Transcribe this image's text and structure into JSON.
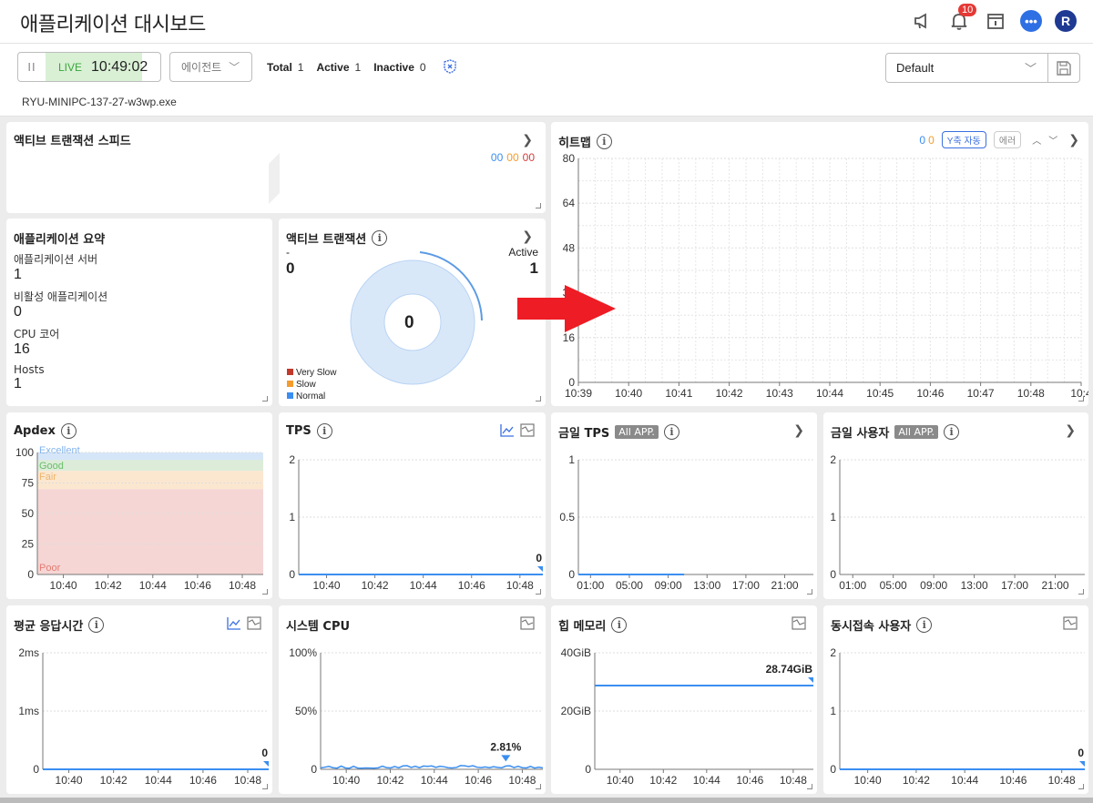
{
  "header": {
    "title": "애플리케이션 대시보드",
    "notification_count": "10",
    "avatar_initial": "R",
    "icons": [
      "megaphone-icon",
      "bell-icon",
      "calendar-info-icon",
      "chat-icon",
      "avatar"
    ]
  },
  "toolbar": {
    "pause_glyph": "II",
    "live_label": "LIVE",
    "live_time": "10:49:02",
    "agent_dropdown": "에이전트",
    "total_label": "Total",
    "total_value": "1",
    "active_label": "Active",
    "active_value": "1",
    "inactive_label": "Inactive",
    "inactive_value": "0",
    "process_name": "RYU-MINIPC-137-27-w3wp.exe",
    "preset": "Default"
  },
  "cards": {
    "speed": {
      "title": "액티브 트랜잭션 스피드",
      "v1": "00",
      "v2": "00",
      "v3": "00",
      "colors": [
        "#3b8ef0",
        "#f39c2c",
        "#d63b3b"
      ]
    },
    "heatmap": {
      "title": "히트맵",
      "count_blue": "0",
      "count_orange": "0",
      "yaxis_button": "Y축 자동",
      "error_button": "에러"
    },
    "summary": {
      "title": "애플리케이션 요약",
      "items": [
        {
          "label": "애플리케이션 서버",
          "value": "1"
        },
        {
          "label": "비활성 애플리케이션",
          "value": "0"
        },
        {
          "label": "CPU 코어",
          "value": "16"
        },
        {
          "label": "Hosts",
          "value": "1"
        }
      ]
    },
    "active_tx": {
      "title": "액티브 트랜잭션",
      "left_label": "-",
      "left_value": "0",
      "right_label": "Active",
      "right_value": "1",
      "center_value": "0",
      "legend": [
        {
          "label": "Very Slow",
          "color": "#c0392b"
        },
        {
          "label": "Slow",
          "color": "#f39c2c"
        },
        {
          "label": "Normal",
          "color": "#3b8ef0"
        }
      ]
    },
    "apdex": {
      "title": "Apdex"
    },
    "tps": {
      "title": "TPS"
    },
    "today_tps": {
      "title": "금일 TPS",
      "pill": "All APP."
    },
    "today_users": {
      "title": "금일 사용자",
      "pill": "All APP."
    },
    "avg_resp": {
      "title": "평균 응답시간"
    },
    "sys_cpu": {
      "title": "시스템 CPU"
    },
    "heap": {
      "title": "힙 메모리"
    },
    "concurrent": {
      "title": "동시접속 사용자"
    }
  },
  "chart_data": [
    {
      "id": "heatmap",
      "type": "heatmap",
      "title": "히트맵",
      "yticks": [
        "0",
        "16",
        "32",
        "48",
        "64",
        "80"
      ],
      "ylim": [
        0,
        80
      ],
      "xticks": [
        "10:39",
        "10:40",
        "10:41",
        "10:42",
        "10:43",
        "10:44",
        "10:45",
        "10:46",
        "10:47",
        "10:48",
        "10:4"
      ],
      "values": []
    },
    {
      "id": "apdex",
      "type": "area",
      "title": "Apdex",
      "yticks": [
        "0",
        "25",
        "50",
        "75",
        "100"
      ],
      "ylim": [
        0,
        100
      ],
      "xticks": [
        "10:40",
        "10:42",
        "10:44",
        "10:46",
        "10:48"
      ],
      "bands": [
        {
          "label": "Excellent",
          "from": 94,
          "to": 100,
          "color": "#d6e6f9",
          "text": "#7fb2ee"
        },
        {
          "label": "Good",
          "from": 85,
          "to": 94,
          "color": "#dcecd9",
          "text": "#6abf69"
        },
        {
          "label": "Fair",
          "from": 70,
          "to": 85,
          "color": "#fbe7d0",
          "text": "#f0b46a"
        },
        {
          "label": "Poor",
          "from": 0,
          "to": 70,
          "color": "#f5d6d4",
          "text": "#e57c74"
        }
      ]
    },
    {
      "id": "tps",
      "type": "line",
      "title": "TPS",
      "yticks": [
        "0",
        "1",
        "2"
      ],
      "ylim": [
        0,
        2
      ],
      "xticks": [
        "10:40",
        "10:42",
        "10:44",
        "10:46",
        "10:48"
      ],
      "values": [
        0,
        0,
        0,
        0,
        0,
        0,
        0,
        0,
        0,
        0
      ],
      "last_label": "0"
    },
    {
      "id": "today_tps",
      "type": "line",
      "title": "금일 TPS",
      "yticks": [
        "0",
        "0.5",
        "1"
      ],
      "ylim": [
        0,
        1
      ],
      "xticks": [
        "01:00",
        "05:00",
        "09:00",
        "13:00",
        "17:00",
        "21:00"
      ],
      "values": [
        0,
        0,
        0,
        0,
        0,
        0,
        0,
        0,
        0,
        0,
        0
      ],
      "value_end_fraction": 0.45
    },
    {
      "id": "today_users",
      "type": "line",
      "title": "금일 사용자",
      "yticks": [
        "0",
        "1",
        "2"
      ],
      "ylim": [
        0,
        2
      ],
      "xticks": [
        "01:00",
        "05:00",
        "09:00",
        "13:00",
        "17:00",
        "21:00"
      ],
      "values": []
    },
    {
      "id": "avg_resp",
      "type": "line",
      "title": "평균 응답시간",
      "yticks": [
        "0",
        "1ms",
        "2ms"
      ],
      "ylim": [
        0,
        2
      ],
      "xticks": [
        "10:40",
        "10:42",
        "10:44",
        "10:46",
        "10:48"
      ],
      "values": [
        0,
        0,
        0,
        0,
        0,
        0,
        0,
        0,
        0,
        0
      ],
      "last_label": "0"
    },
    {
      "id": "sys_cpu",
      "type": "line",
      "title": "시스템 CPU",
      "yticks": [
        "0",
        "50%",
        "100%"
      ],
      "ylim": [
        0,
        100
      ],
      "xticks": [
        "10:40",
        "10:42",
        "10:44",
        "10:46",
        "10:48"
      ],
      "values": [
        1.2,
        1.8,
        2.5,
        1.4,
        1.0,
        2.8,
        1.2,
        0.9,
        2.6,
        1.1,
        1.0,
        1.2,
        1.1,
        1.0,
        1.3,
        2.7,
        1.5,
        1.2,
        2.4,
        1.3,
        2.9,
        3.1,
        1.6,
        2.6,
        1.4,
        2.8,
        2.5,
        2.9,
        1.7,
        2.6,
        2.2,
        1.4,
        1.2,
        1.6,
        3.2,
        3.0,
        2.4,
        3.1,
        1.8,
        1.5,
        2.0,
        1.4,
        2.2,
        1.7,
        1.3,
        2.81,
        3.0,
        1.5,
        2.6,
        1.4,
        1.2,
        2.5,
        1.1,
        1.8,
        1.2
      ],
      "marker_label": "2.81%",
      "marker_index": 45
    },
    {
      "id": "heap",
      "type": "line",
      "title": "힙 메모리",
      "yticks": [
        "0",
        "20GiB",
        "40GiB"
      ],
      "ylim": [
        0,
        40
      ],
      "xticks": [
        "10:40",
        "10:42",
        "10:44",
        "10:46",
        "10:48"
      ],
      "values": [
        28.74,
        28.74,
        28.74,
        28.74,
        28.74,
        28.74,
        28.74,
        28.74,
        28.74,
        28.74
      ],
      "last_label": "28.74GiB"
    },
    {
      "id": "concurrent",
      "type": "line",
      "title": "동시접속 사용자",
      "yticks": [
        "0",
        "1",
        "2"
      ],
      "ylim": [
        0,
        2
      ],
      "xticks": [
        "10:40",
        "10:42",
        "10:44",
        "10:46",
        "10:48"
      ],
      "values": [
        0,
        0,
        0,
        0,
        0,
        0,
        0,
        0,
        0,
        0
      ],
      "last_label": "0"
    }
  ]
}
